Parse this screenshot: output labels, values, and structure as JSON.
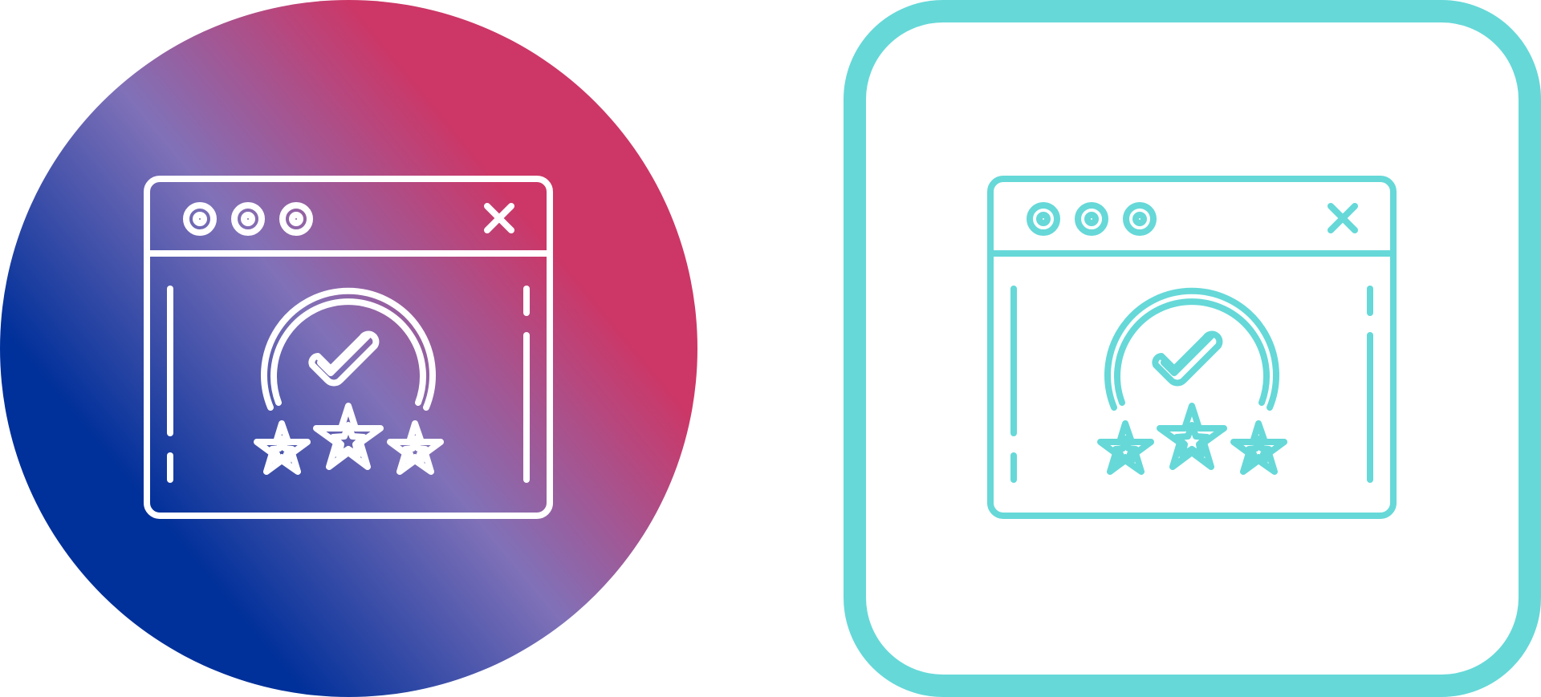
{
  "icons": [
    {
      "name": "website-rating-icon",
      "style": "gradient-circle",
      "background": "circle",
      "gradient_colors": [
        "#00309a",
        "#8071b8",
        "#cc3767"
      ],
      "stroke_color": "#ffffff"
    },
    {
      "name": "website-rating-icon",
      "style": "outline-rounded-square",
      "background": "rounded-square",
      "frame_color": "#66d8d8",
      "stroke_color": "#66d8d8"
    }
  ],
  "symbol": {
    "window_buttons": [
      "circle",
      "circle",
      "circle"
    ],
    "close_glyph": "x-icon",
    "badge_glyph": "checkmark-icon",
    "stars": 3
  }
}
